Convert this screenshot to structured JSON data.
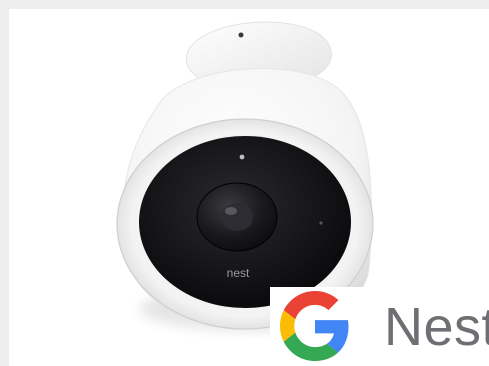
{
  "image": {
    "subject": "nest-cam-iq-outdoor",
    "device_logo_text": "nest",
    "colors": {
      "background": "#ffffff",
      "frame": "#ededed",
      "camera_body": "#f8f8f8",
      "lens_bezel": "#111114",
      "brand_text": "#6e6f72",
      "google_blue": "#4285F4",
      "google_red": "#EA4335",
      "google_yellow": "#FBBC05",
      "google_green": "#34A853"
    }
  },
  "brand": {
    "logo_icon": "google-g-icon",
    "text": "Nest"
  }
}
